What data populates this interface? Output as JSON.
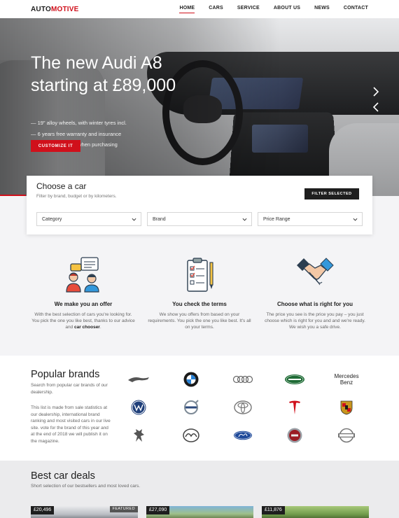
{
  "header": {
    "logo_part1": "AUTO",
    "logo_part2": "MOTIVE",
    "nav": [
      {
        "label": "HOME",
        "active": true
      },
      {
        "label": "CARS",
        "active": false
      },
      {
        "label": "SERVICE",
        "active": false
      },
      {
        "label": "ABOUT US",
        "active": false
      },
      {
        "label": "NEWS",
        "active": false
      },
      {
        "label": "CONTACT",
        "active": false
      }
    ]
  },
  "hero": {
    "title": "The new Audi A8 starting at £89,000",
    "features": [
      "— 19\" alloy wheels, with winter tyres incl.",
      "— 6 years free warranty and insurance",
      "— 0% banking fees when purchasing"
    ],
    "cta_label": "CUSTOMIZE IT",
    "next_icon": "chevron-right-icon",
    "prev_icon": "chevron-left-icon"
  },
  "search": {
    "title": "Choose a car",
    "subtitle": "Filter by brand, budget or by kilometers.",
    "filter_button": "FILTER SELECTED",
    "selects": [
      "Category",
      "Brand",
      "Price Range"
    ]
  },
  "features": [
    {
      "icon": "people-chat-icon",
      "title": "We make you an offer",
      "text_before": "With the best selection of cars you're looking for. You pick the one you like best, thanks to our advice and ",
      "text_bold": "car chooser",
      "text_after": "."
    },
    {
      "icon": "checklist-icon",
      "title": "You check the terms",
      "text_before": "We show you offers from based on your requirements. You pick the one you like best. It's all on your terms.",
      "text_bold": "",
      "text_after": ""
    },
    {
      "icon": "handshake-icon",
      "title": "Choose what is right for you",
      "text_before": "The price you see is the price you pay – you just choose which is right for you and and we're ready. We wish you a safe drive.",
      "text_bold": "",
      "text_after": ""
    }
  ],
  "brands": {
    "title": "Popular brands",
    "subtitle": "Search from popular car brands of our dealership.",
    "note": "This list is made from sale statistics at our dealership, international brand ranking and most visited cars in our live site. vote for the brand of this year and at the end of 2018 we will publish it on the magazine.",
    "mercedes_line1": "Mercedes",
    "mercedes_line2": "Benz",
    "logos": [
      "jaguar-logo",
      "bmw-logo",
      "audi-logo",
      "land-rover-logo",
      "mercedes-benz-text",
      "volkswagen-logo",
      "volvo-logo",
      "toyota-logo",
      "tesla-logo",
      "porsche-logo",
      "peugeot-logo",
      "mazda-logo",
      "ford-logo",
      "fiat-logo",
      "nissan-logo"
    ]
  },
  "deals": {
    "title": "Best car deals",
    "subtitle": "Short selection of our bestsellers and most loved cars.",
    "items": [
      {
        "price": "£20,496",
        "badge": "FEATURED"
      },
      {
        "price": "£27,090",
        "badge": ""
      },
      {
        "price": "£11,876",
        "badge": ""
      }
    ]
  },
  "colors": {
    "accent": "#d0101b",
    "dark": "#1e1e1e"
  }
}
